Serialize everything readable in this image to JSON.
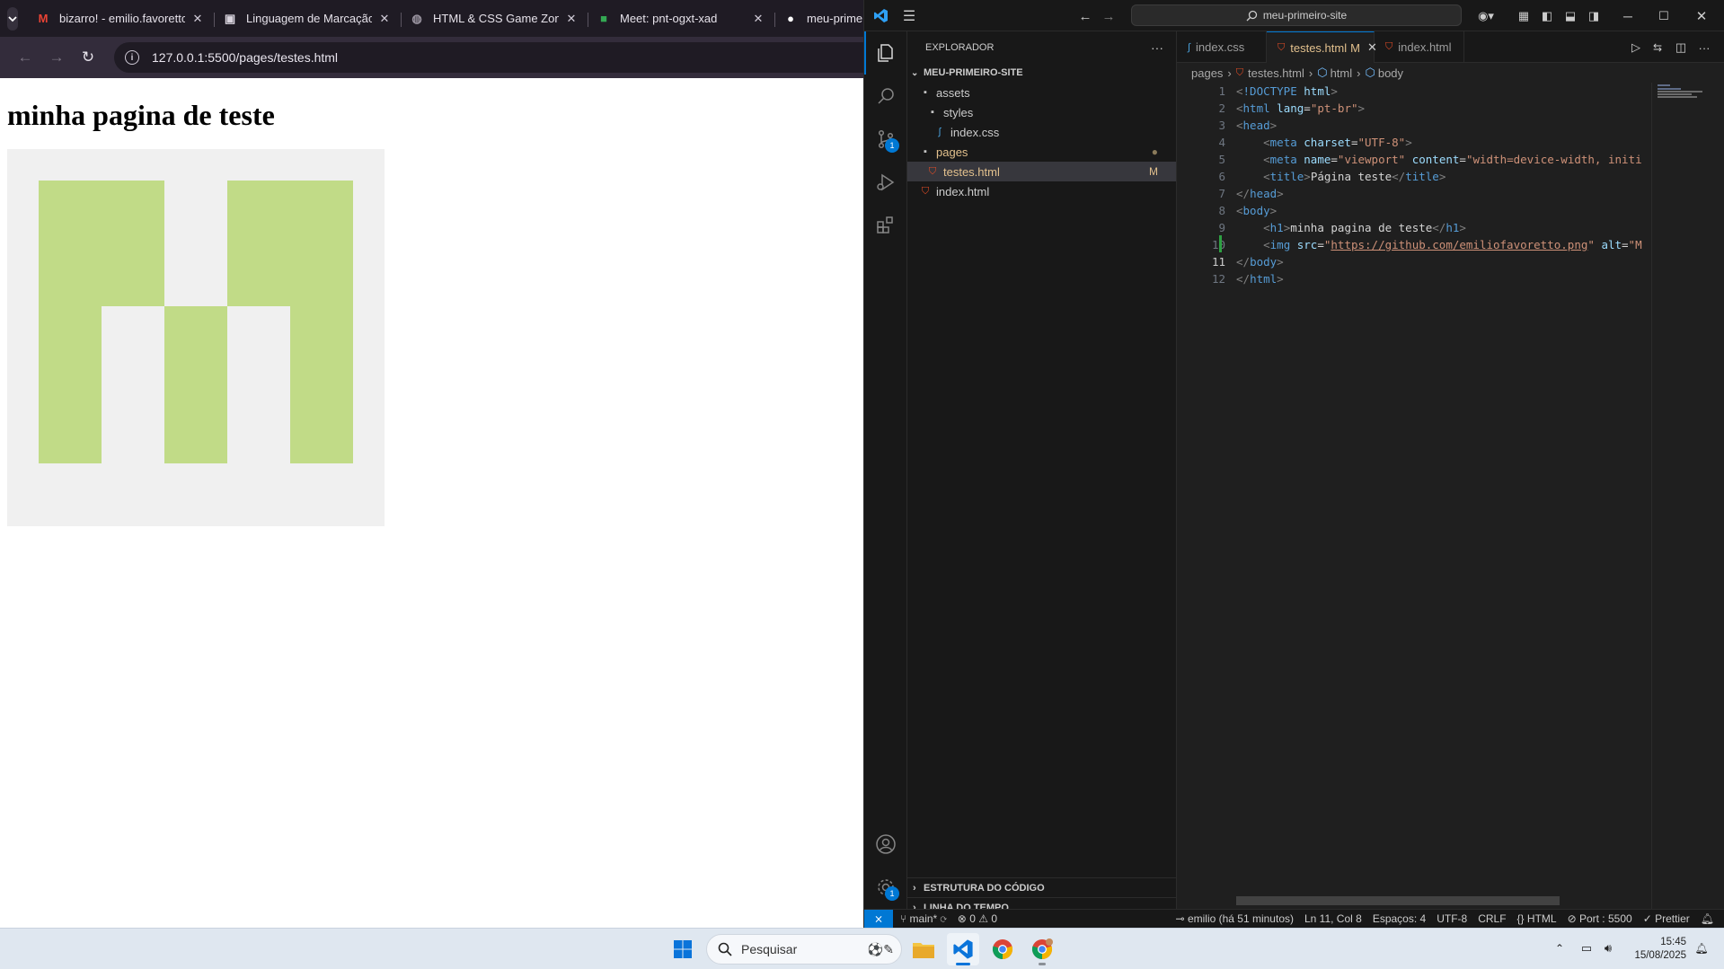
{
  "browser": {
    "tabs": [
      {
        "title": "bizarro! - emilio.favoretto",
        "icon": "gmail-icon"
      },
      {
        "title": "Linguagem de Marcação",
        "icon": "document-icon"
      },
      {
        "title": "HTML & CSS Game Zone",
        "icon": "globe-icon"
      },
      {
        "title": "Meet: pnt-ogxt-xad",
        "icon": "meet-icon"
      },
      {
        "title": "meu-prime",
        "icon": "github-icon"
      }
    ],
    "url": "127.0.0.1:5500/pages/testes.html",
    "page": {
      "heading": "minha pagina de teste",
      "avatar_color": "#c1db87",
      "avatar_bg": "#f0f0f0"
    }
  },
  "vscode": {
    "command_center": "meu-primeiro-site",
    "activity_badges": {
      "source_control": "1",
      "manage": "1"
    },
    "explorer": {
      "title": "EXPLORADOR",
      "root": "MEU-PRIMEIRO-SITE",
      "items": [
        {
          "name": "assets",
          "type": "folder",
          "depth": 0
        },
        {
          "name": "styles",
          "type": "folder",
          "depth": 1
        },
        {
          "name": "index.css",
          "type": "css",
          "depth": 2
        },
        {
          "name": "pages",
          "type": "folder",
          "depth": 0,
          "status": "●"
        },
        {
          "name": "testes.html",
          "type": "html",
          "depth": 1,
          "status": "M",
          "selected": true
        },
        {
          "name": "index.html",
          "type": "html",
          "depth": 0
        }
      ],
      "outline": "ESTRUTURA DO CÓDIGO",
      "timeline": "LINHA DO TEMPO"
    },
    "editor_tabs": [
      {
        "name": "index.css",
        "type": "css"
      },
      {
        "name": "testes.html",
        "type": "html",
        "status": "M",
        "active": true
      },
      {
        "name": "index.html",
        "type": "html"
      }
    ],
    "breadcrumb": [
      "pages",
      "testes.html",
      "html",
      "body"
    ],
    "code_lines": [
      [
        [
          "p",
          "<"
        ],
        [
          "t",
          "!DOCTYPE"
        ],
        [
          "tx",
          " "
        ],
        [
          "a",
          "html"
        ],
        [
          "p",
          ">"
        ]
      ],
      [
        [
          "p",
          "<"
        ],
        [
          "t",
          "html"
        ],
        [
          "tx",
          " "
        ],
        [
          "a",
          "lang"
        ],
        [
          "tx",
          "="
        ],
        [
          "s",
          "\"pt-br\""
        ],
        [
          "p",
          ">"
        ]
      ],
      [
        [
          "p",
          "<"
        ],
        [
          "t",
          "head"
        ],
        [
          "p",
          ">"
        ]
      ],
      [
        [
          "tx",
          "    "
        ],
        [
          "p",
          "<"
        ],
        [
          "t",
          "meta"
        ],
        [
          "tx",
          " "
        ],
        [
          "a",
          "charset"
        ],
        [
          "tx",
          "="
        ],
        [
          "s",
          "\"UTF-8\""
        ],
        [
          "p",
          ">"
        ]
      ],
      [
        [
          "tx",
          "    "
        ],
        [
          "p",
          "<"
        ],
        [
          "t",
          "meta"
        ],
        [
          "tx",
          " "
        ],
        [
          "a",
          "name"
        ],
        [
          "tx",
          "="
        ],
        [
          "s",
          "\"viewport\""
        ],
        [
          "tx",
          " "
        ],
        [
          "a",
          "content"
        ],
        [
          "tx",
          "="
        ],
        [
          "s",
          "\"width=device-width, initi"
        ]
      ],
      [
        [
          "tx",
          "    "
        ],
        [
          "p",
          "<"
        ],
        [
          "t",
          "title"
        ],
        [
          "p",
          ">"
        ],
        [
          "tx",
          "Página teste"
        ],
        [
          "p",
          "</"
        ],
        [
          "t",
          "title"
        ],
        [
          "p",
          ">"
        ]
      ],
      [
        [
          "p",
          "</"
        ],
        [
          "t",
          "head"
        ],
        [
          "p",
          ">"
        ]
      ],
      [
        [
          "p",
          "<"
        ],
        [
          "t",
          "body"
        ],
        [
          "p",
          ">"
        ]
      ],
      [
        [
          "tx",
          "    "
        ],
        [
          "p",
          "<"
        ],
        [
          "t",
          "h1"
        ],
        [
          "p",
          ">"
        ],
        [
          "tx",
          "minha pagina de teste"
        ],
        [
          "p",
          "</"
        ],
        [
          "t",
          "h1"
        ],
        [
          "p",
          ">"
        ]
      ],
      [
        [
          "tx",
          "    "
        ],
        [
          "p",
          "<"
        ],
        [
          "t",
          "img"
        ],
        [
          "tx",
          " "
        ],
        [
          "a",
          "src"
        ],
        [
          "tx",
          "="
        ],
        [
          "s",
          "\""
        ],
        [
          "s u",
          "https://github.com/emiliofavoretto.png"
        ],
        [
          "s",
          "\""
        ],
        [
          "tx",
          " "
        ],
        [
          "a",
          "alt"
        ],
        [
          "tx",
          "="
        ],
        [
          "s",
          "\"M"
        ]
      ],
      [
        [
          "p",
          "</"
        ],
        [
          "t",
          "body"
        ],
        [
          "p",
          ">"
        ]
      ],
      [
        [
          "p",
          "</"
        ],
        [
          "t",
          "html"
        ],
        [
          "p",
          ">"
        ]
      ]
    ],
    "line_numbers": [
      "1",
      "2",
      "3",
      "4",
      "5",
      "6",
      "7",
      "8",
      "9",
      "10",
      "11",
      "12"
    ],
    "current_line": 11,
    "status": {
      "branch": "main*",
      "errors": "0",
      "warnings": "0",
      "blame": "emilio (há 51 minutos)",
      "cursor": "Ln 11, Col 8",
      "spaces": "Espaços: 4",
      "encoding": "UTF-8",
      "eol": "CRLF",
      "language": "HTML",
      "port": "Port : 5500",
      "formatter": "Prettier"
    }
  },
  "taskbar": {
    "search_placeholder": "Pesquisar",
    "time": "15:45",
    "date": "15/08/2025"
  }
}
